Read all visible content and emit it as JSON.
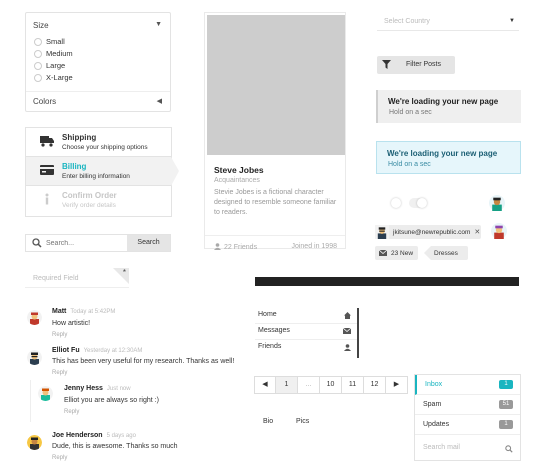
{
  "filters": {
    "size_label": "Size",
    "sizes": [
      "Small",
      "Medium",
      "Large",
      "X-Large"
    ],
    "colors_label": "Colors"
  },
  "steps": [
    {
      "title": "Shipping",
      "subtitle": "Choose your shipping options",
      "icon": "truck-icon",
      "state": "done"
    },
    {
      "title": "Billing",
      "subtitle": "Enter billing information",
      "icon": "credit-card-icon",
      "state": "active"
    },
    {
      "title": "Confirm Order",
      "subtitle": "Verify order details",
      "icon": "info-icon",
      "state": "disabled"
    }
  ],
  "search": {
    "placeholder": "Search...",
    "button": "Search"
  },
  "required_field": {
    "placeholder": "Required Field",
    "marker": "*"
  },
  "comments": [
    {
      "author": "Matt",
      "time": "Today at 5:42PM",
      "text": "How artistic!",
      "reply": "Reply"
    },
    {
      "author": "Elliot Fu",
      "time": "Yesterday at 12:30AM",
      "text": "This has been very useful for my research. Thanks as well!",
      "reply": "Reply"
    },
    {
      "author": "Jenny Hess",
      "time": "Just now",
      "text": "Elliot you are always so right :)",
      "reply": "Reply"
    },
    {
      "author": "Joe Henderson",
      "time": "5 days ago",
      "text": "Dude, this is awesome. Thanks so much",
      "reply": "Reply"
    }
  ],
  "profile_card": {
    "name": "Steve Jobes",
    "meta": "Acquaintances",
    "description": "Stevie Jobes is a fictional character designed to resemble someone familiar to readers.",
    "friends": "22 Friends",
    "joined": "Joined in 1998"
  },
  "progress": {
    "percent": 100
  },
  "menu": {
    "items": [
      {
        "label": "Home",
        "icon": "home-icon"
      },
      {
        "label": "Messages",
        "icon": "mail-icon"
      },
      {
        "label": "Friends",
        "icon": "user-icon"
      }
    ]
  },
  "pagination": {
    "prev": "◀",
    "pages": [
      "1",
      "...",
      "10",
      "11",
      "12"
    ],
    "next": "▶",
    "active": "1"
  },
  "tabs": [
    "Bio",
    "Pics"
  ],
  "country_select": {
    "placeholder": "Select Country"
  },
  "filter_button": {
    "label": "Filter Posts"
  },
  "messages": [
    {
      "title": "We're loading your new page",
      "subtitle": "Hold on a sec"
    },
    {
      "title": "We're loading your new page",
      "subtitle": "Hold on a sec"
    }
  ],
  "labels": {
    "email_chip": "jkitsune@newrepublic.com",
    "new_count": "23 New",
    "tag": "Dresses"
  },
  "inbox": {
    "items": [
      {
        "label": "Inbox",
        "count": "1",
        "color": "#19b5c0"
      },
      {
        "label": "Spam",
        "count": "51",
        "color": "#999999"
      },
      {
        "label": "Updates",
        "count": "1",
        "color": "#999999"
      }
    ],
    "search_placeholder": "Search mail"
  },
  "colors": {
    "accent": "#19b5c0",
    "info_bg": "#e6f6fb"
  }
}
